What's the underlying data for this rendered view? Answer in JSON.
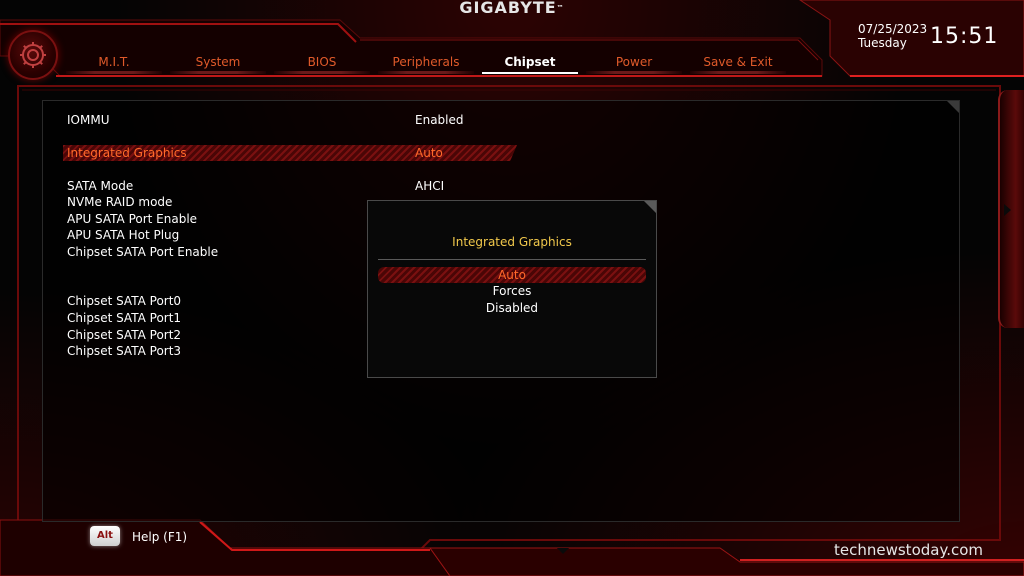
{
  "brand": {
    "name": "GIGABYTE",
    "trademark": "™"
  },
  "datetime": {
    "date": "07/25/2023",
    "day": "Tuesday",
    "time": "15:51"
  },
  "tabs": [
    {
      "label": "M.I.T."
    },
    {
      "label": "System"
    },
    {
      "label": "BIOS"
    },
    {
      "label": "Peripherals"
    },
    {
      "label": "Chipset",
      "active": true
    },
    {
      "label": "Power"
    },
    {
      "label": "Save & Exit"
    }
  ],
  "settings": [
    {
      "label": "IOMMU",
      "value": "Enabled"
    },
    {
      "label": "Integrated Graphics",
      "value": "Auto",
      "highlighted": true
    },
    {
      "label": "SATA Mode",
      "value": "AHCI"
    },
    {
      "label": "NVMe RAID mode",
      "value": ""
    },
    {
      "label": "APU SATA Port Enable",
      "value": ""
    },
    {
      "label": "APU SATA Hot Plug",
      "value": ""
    },
    {
      "label": "Chipset SATA Port Enable",
      "value": ""
    },
    {
      "label": "Chipset SATA Port0",
      "value": ""
    },
    {
      "label": "Chipset SATA Port1",
      "value": ""
    },
    {
      "label": "Chipset SATA Port2",
      "value": ""
    },
    {
      "label": "Chipset SATA Port3",
      "value": ""
    }
  ],
  "popup": {
    "title": "Integrated Graphics",
    "options": [
      "Auto",
      "Forces",
      "Disabled"
    ],
    "selected": "Auto"
  },
  "footer": {
    "key": "Alt",
    "help_label": "Help (F1)"
  },
  "watermark": "technewstoday.com",
  "colors": {
    "accent_red": "#c01818",
    "highlight_text": "#ff6a2a",
    "popup_title": "#f2c94c"
  }
}
